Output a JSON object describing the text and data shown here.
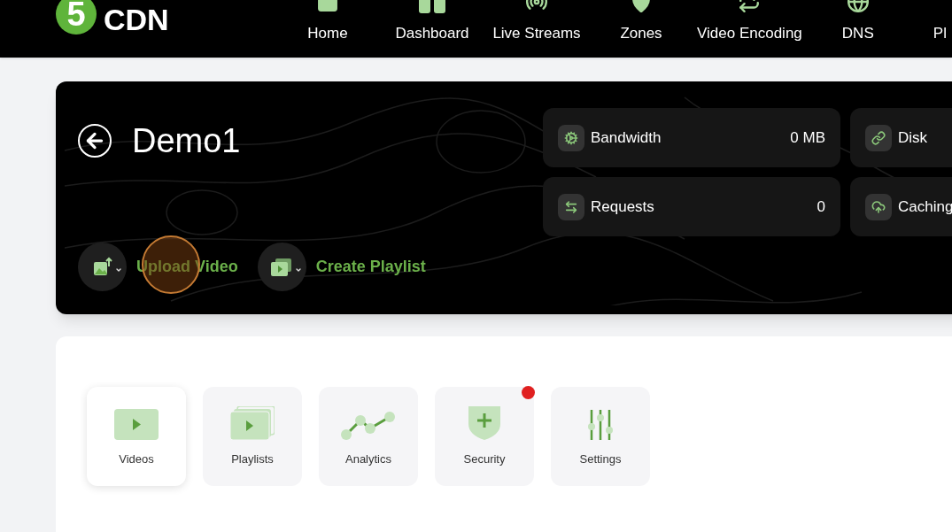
{
  "logo": {
    "digit": "5",
    "text": "CDN"
  },
  "nav": [
    {
      "label": "Home",
      "kind": "home"
    },
    {
      "label": "Dashboard",
      "kind": "dashboard"
    },
    {
      "label": "Live Streams",
      "kind": "live"
    },
    {
      "label": "Zones",
      "kind": "zones"
    },
    {
      "label": "Video Encoding",
      "kind": "encoding"
    },
    {
      "label": "DNS",
      "kind": "dns"
    },
    {
      "label": "Pl",
      "kind": "none"
    }
  ],
  "zone": {
    "title": "Demo1"
  },
  "actions": [
    {
      "label": "Upload Video",
      "kind": "upload"
    },
    {
      "label": "Create Playlist",
      "kind": "playlist"
    }
  ],
  "stats": [
    {
      "label": "Bandwidth",
      "value": "0 MB",
      "kind": "bandwidth"
    },
    {
      "label": "Disk",
      "kind": "disk"
    },
    {
      "label": "Requests",
      "value": "0",
      "kind": "requests"
    },
    {
      "label": "Caching",
      "kind": "caching"
    }
  ],
  "tiles": [
    {
      "label": "Videos",
      "kind": "videos",
      "selected": true,
      "alert": false
    },
    {
      "label": "Playlists",
      "kind": "playlists",
      "selected": false,
      "alert": false
    },
    {
      "label": "Analytics",
      "kind": "analytics",
      "selected": false,
      "alert": false
    },
    {
      "label": "Security",
      "kind": "security",
      "selected": false,
      "alert": true
    },
    {
      "label": "Settings",
      "kind": "settings",
      "selected": false,
      "alert": false
    }
  ]
}
